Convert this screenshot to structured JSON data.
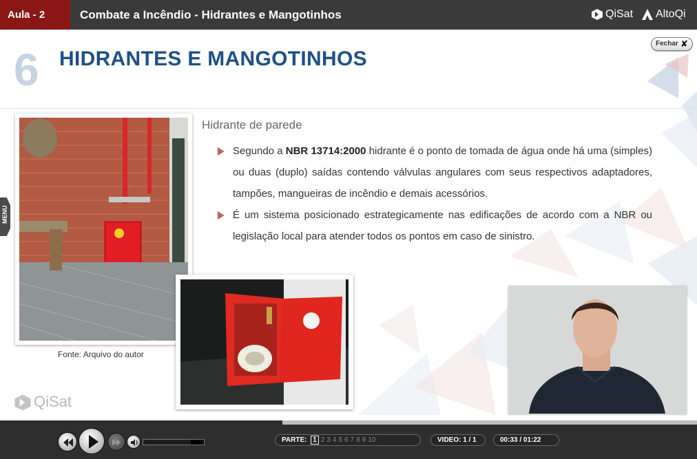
{
  "header": {
    "lesson_tag": "Aula - 2",
    "course_title": "Combate a Incêndio - Hidrantes e Mangotinhos",
    "brand_1": "QiSat",
    "brand_2": "AltoQi"
  },
  "slide": {
    "number": "6",
    "title": "HIDRANTES E MANGOTINHOS",
    "close_label": "Fechar",
    "menu_label": "MENU",
    "subtitle": "Hidrante de parede",
    "bullet_1_pre": "Segundo a ",
    "bullet_1_bold": "NBR 13714:2000",
    "bullet_1_post": " hidrante é o ponto de tomada de água onde há uma (simples) ou duas (duplo) saídas contendo válvulas angulares com seus respectivos adaptadores, tampões, mangueiras de incêndio e demais acessórios.",
    "bullet_2": "É um sistema posicionado estrategicamente nas edificações de acordo com a NBR ou legislação local para atender todos os pontos em caso de sinistro.",
    "photo_caption": "Fonte: Arquivo do autor",
    "watermark": "QiSat"
  },
  "player": {
    "progress_fraction": 0.405,
    "parts_label": "PARTE:",
    "parts": [
      "1",
      "2",
      "3",
      "4",
      "5",
      "6",
      "7",
      "8",
      "9",
      "10"
    ],
    "active_part": "1",
    "video_label": "VIDEO:",
    "video_value": "1 / 1",
    "time": "00:33 / 01:22",
    "volume_level": 0.2
  },
  "colors": {
    "header_bg": "#3a3a3a",
    "lesson_tag_bg": "#8a1616",
    "title_blue": "#1f4f86",
    "number_color": "#c6d4e2",
    "bullet_arrow": "#c0616b"
  },
  "icons": [
    "qisat-logo-icon",
    "altoqi-logo-icon",
    "close-x-icon",
    "rewind-icon",
    "play-icon",
    "fast-forward-icon",
    "volume-icon"
  ]
}
